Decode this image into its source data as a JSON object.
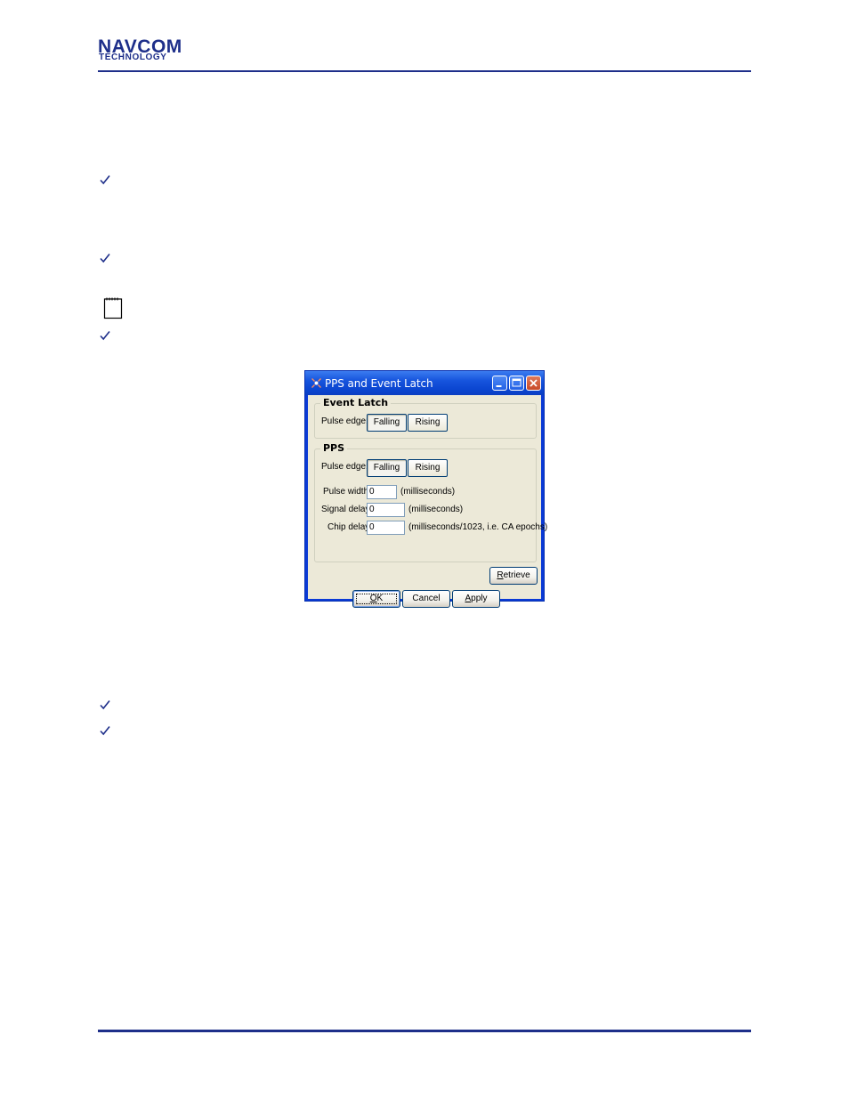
{
  "header": {
    "logo_line1": "NAVCOM",
    "logo_line2": "TECHNOLOGY"
  },
  "icons": {
    "check": "checkmark-icon",
    "note": "note-icon",
    "app": "satellite-icon"
  },
  "colors": {
    "brand": "#1e2f8a",
    "xp_title": "#0a44cf",
    "dialog_face": "#ece9d8"
  },
  "dialog": {
    "title": "PPS and Event Latch",
    "event_latch": {
      "label": "Event Latch",
      "pulse_edge_label": "Pulse edge:",
      "falling": "Falling",
      "rising": "Rising",
      "selected": "Falling"
    },
    "pps": {
      "label": "PPS",
      "pulse_edge_label": "Pulse edge:",
      "falling": "Falling",
      "rising": "Rising",
      "selected": "Falling",
      "pulse_width_label": "Pulse width:",
      "pulse_width_value": "0",
      "pulse_width_unit": "(milliseconds)",
      "signal_delay_label": "Signal delay:",
      "signal_delay_value": "0",
      "signal_delay_unit": "(milliseconds)",
      "chip_delay_label": "Chip delay:",
      "chip_delay_value": "0",
      "chip_delay_unit": "(milliseconds/1023, i.e. CA epochs)"
    },
    "retrieve_first": "R",
    "retrieve_rest": "etrieve",
    "ok_first": "O",
    "ok_rest": "K",
    "cancel": "Cancel",
    "apply_first": "A",
    "apply_rest": "pply"
  }
}
